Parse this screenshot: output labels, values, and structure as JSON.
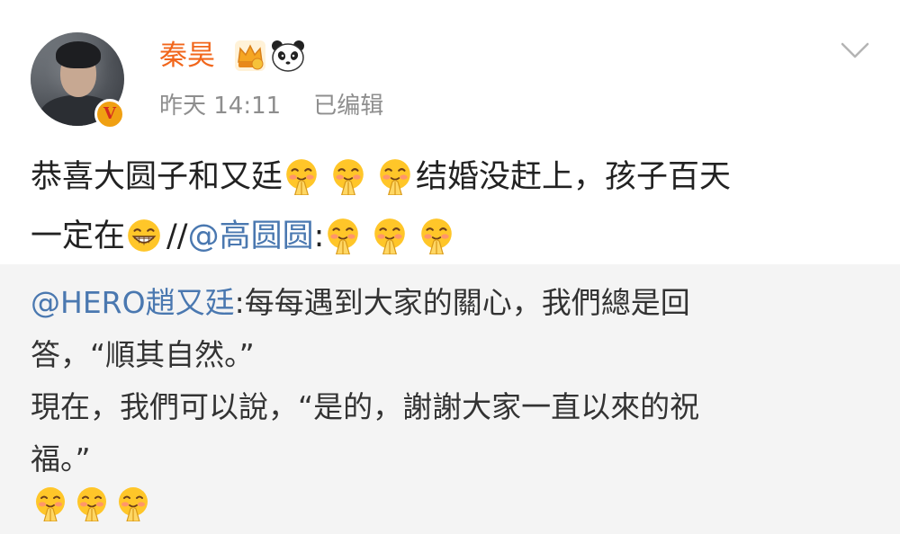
{
  "post": {
    "author": "秦昊",
    "time": "昨天 14:11",
    "edited": "已编辑",
    "verified_badge": "V",
    "icons": [
      "crown-icon",
      "panda-icon",
      "chevron-down-icon"
    ],
    "text_part1": "恭喜大圆子和又廷",
    "text_part2": "结婚没赶上，孩子百天",
    "text_part3": "一定在",
    "text_part4": "//",
    "mention": "@高圆圆",
    "text_part5": ":",
    "emoji_names": [
      "praying-hands-emoji",
      "grinning-face-emoji"
    ]
  },
  "repost": {
    "mention": "@HERO趙又廷",
    "text_part1": ":每每遇到大家的關心，我們總是回",
    "text_part2": "答，“順其自然。”",
    "text_part3": "現在，我們可以說，“是的，謝謝大家一直以來的祝",
    "text_part4": "福。”"
  },
  "colors": {
    "username": "#f1661b",
    "mention": "#4a78b0",
    "meta": "#8e8e8e",
    "repost_bg": "#f4f4f4",
    "verified": "#f0a012"
  }
}
